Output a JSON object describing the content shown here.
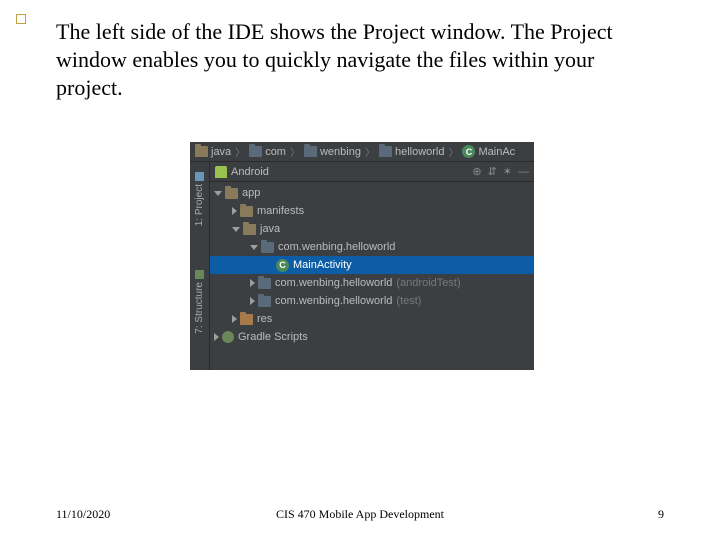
{
  "slide": {
    "body_text": "The left side of the IDE shows the Project window. The Project window enables you to quickly navigate the files within your project."
  },
  "ide": {
    "breadcrumb": [
      "java",
      "com",
      "wenbing",
      "helloworld",
      "MainAc"
    ],
    "panel_title": "Android",
    "tool_tabs": {
      "project": "1: Project",
      "structure": "7: Structure"
    },
    "header_icons": {
      "target": "⊕",
      "collapse": "⇵",
      "gear": "✶",
      "hide": "—"
    },
    "tree": {
      "app": "app",
      "manifests": "manifests",
      "java": "java",
      "pkg_main": "com.wenbing.helloworld",
      "main_activity": "MainActivity",
      "pkg_android_test": "com.wenbing.helloworld",
      "pkg_android_test_suffix": "(androidTest)",
      "pkg_test": "com.wenbing.helloworld",
      "pkg_test_suffix": "(test)",
      "res": "res",
      "gradle": "Gradle Scripts"
    }
  },
  "footer": {
    "date": "11/10/2020",
    "title": "CIS 470 Mobile App Development",
    "page": "9"
  }
}
